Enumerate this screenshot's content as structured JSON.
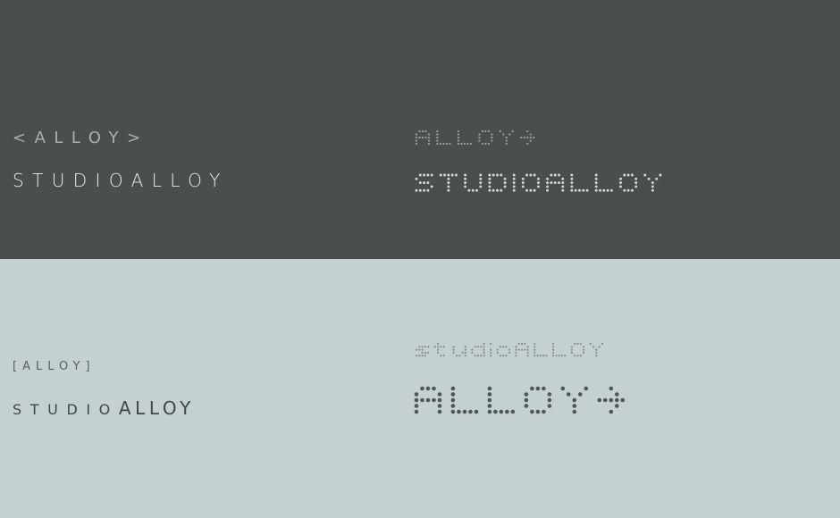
{
  "colors": {
    "dark_panel": "#494f4e",
    "light_panel": "#c5d1d0",
    "dot_dark_panel_top": "#98a09f",
    "dot_dark_panel_bottom": "#d3d9d8",
    "dot_light_panel_top": "#858d8c",
    "dot_light_panel_bottom": "#4f5655"
  },
  "dark_panel": {
    "mark_bracket": "<ALLOY>",
    "mark_full": "STUDIOALLOY",
    "dot_mark_short": "ALLOY+",
    "dot_mark_full": "STUDIOALLOY"
  },
  "light_panel": {
    "mark_bracket": "[ALLOY]",
    "mark_full_small": "STUDIO",
    "mark_full_big": "ALLOY",
    "dot_mark_small": "studioALLOY",
    "dot_mark_big": "ALLOY+"
  }
}
